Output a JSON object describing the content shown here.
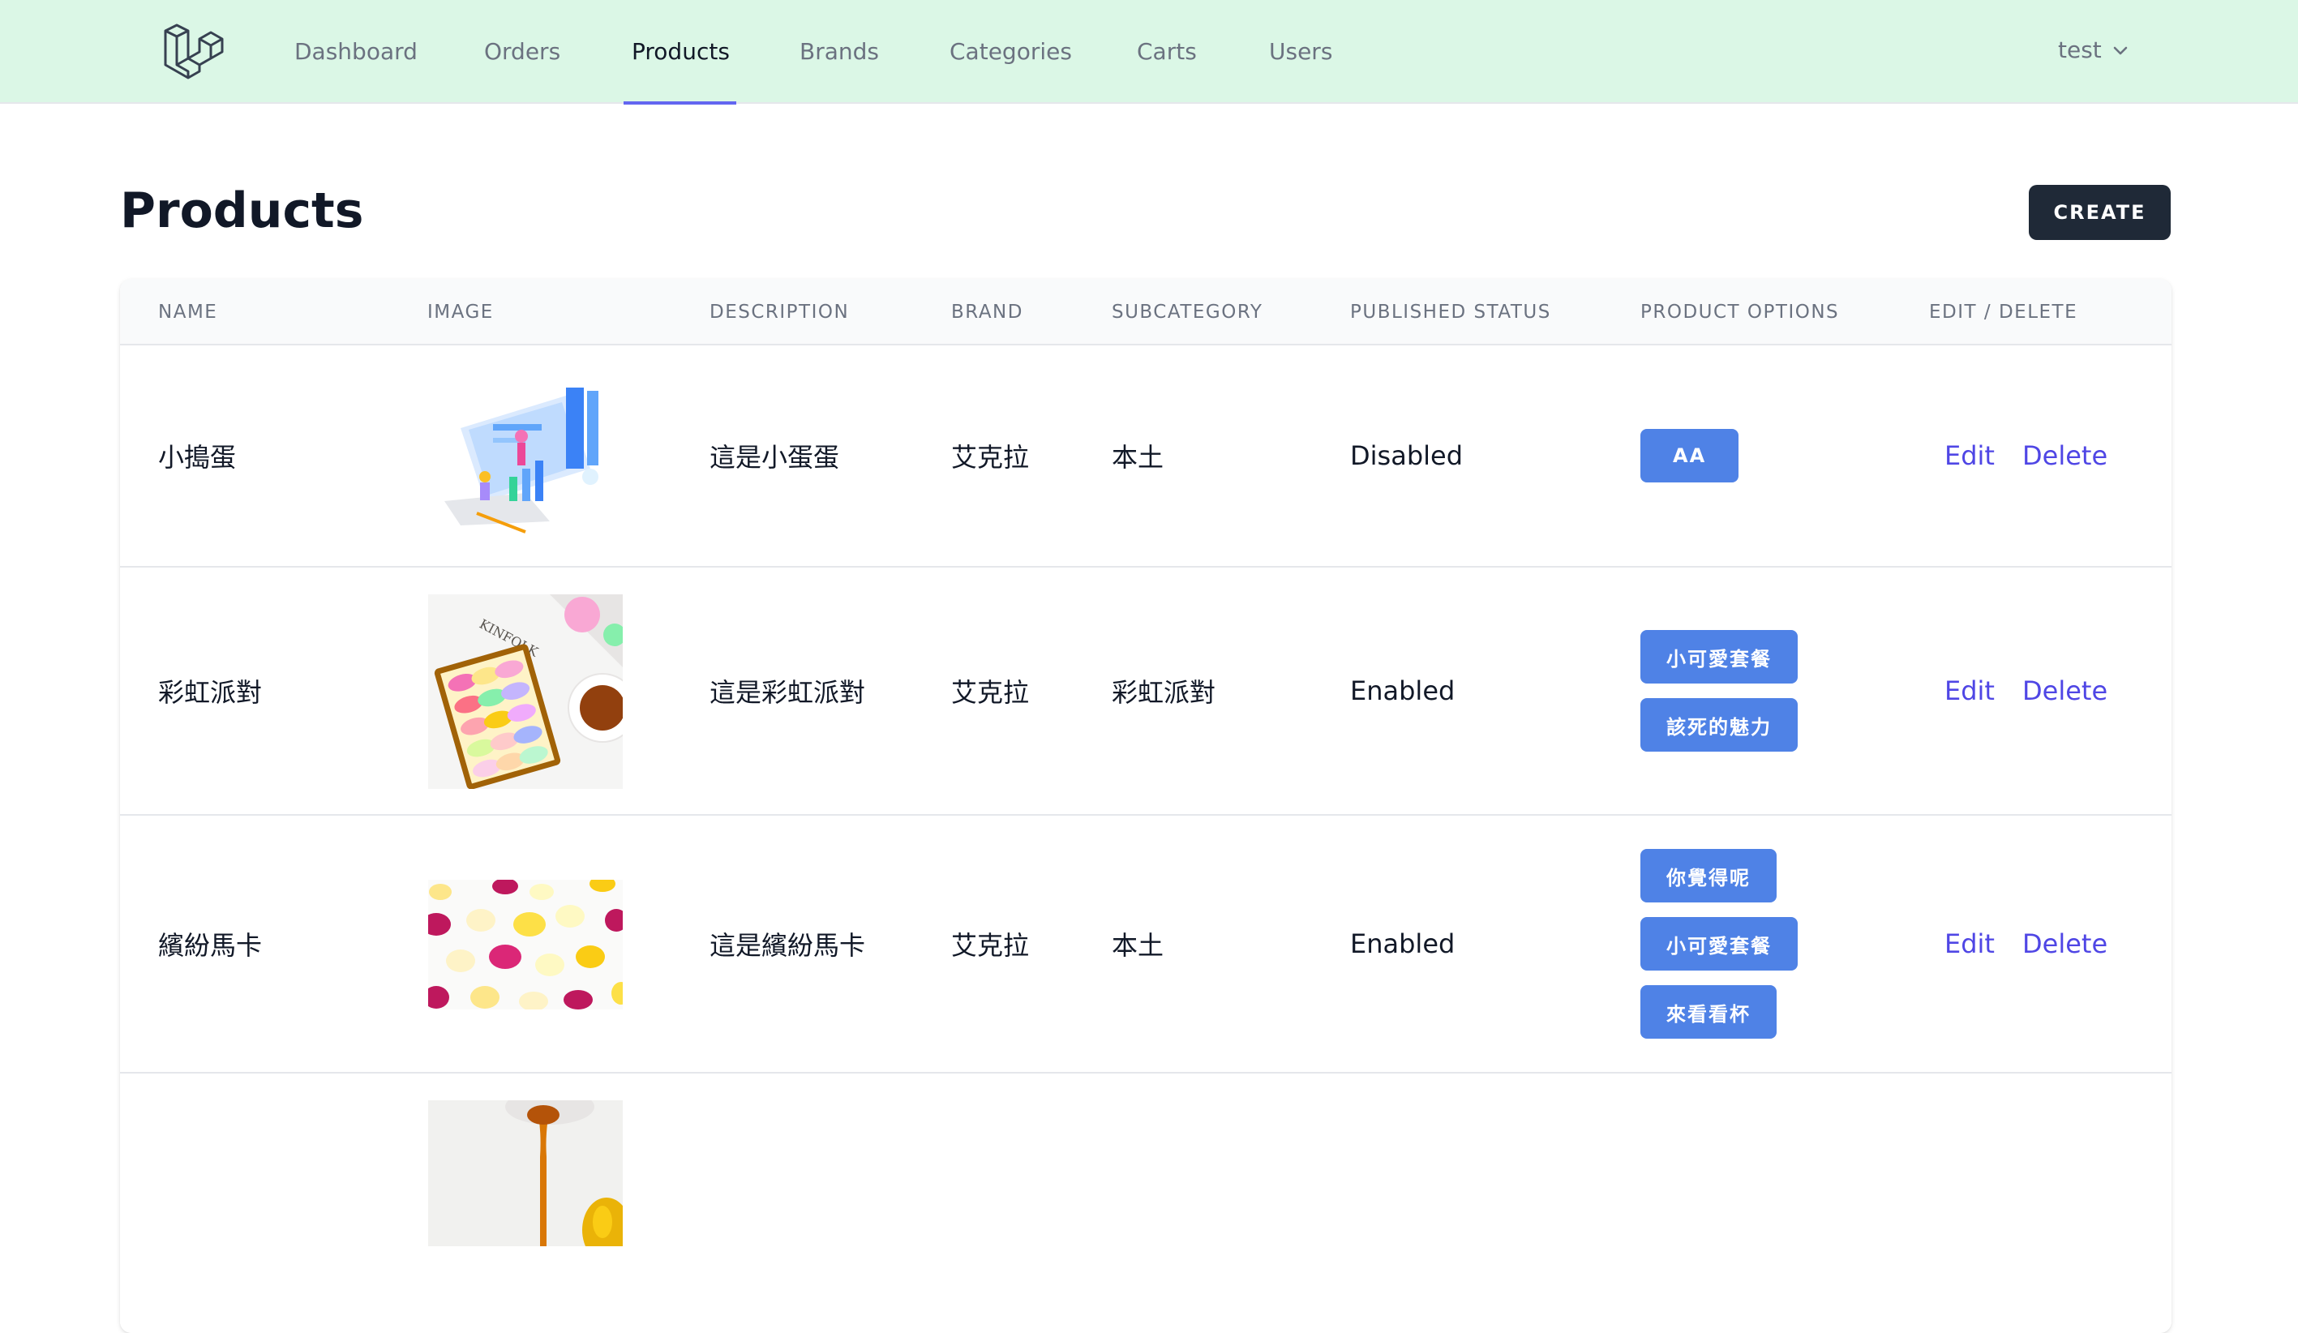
{
  "nav": {
    "items": [
      {
        "label": "Dashboard",
        "active": false
      },
      {
        "label": "Orders",
        "active": false
      },
      {
        "label": "Products",
        "active": true
      },
      {
        "label": "Brands",
        "active": false
      },
      {
        "label": "Categories",
        "active": false
      },
      {
        "label": "Carts",
        "active": false
      },
      {
        "label": "Users",
        "active": false
      }
    ],
    "user": "test",
    "logo_icon": "laravel-logo-icon",
    "active_underline_color": "#6366f1",
    "background_color": "#dbf7e6"
  },
  "page": {
    "title": "Products",
    "create_label": "CREATE"
  },
  "table": {
    "headers": [
      "NAME",
      "IMAGE",
      "DESCRIPTION",
      "BRAND",
      "SUBCATEGORY",
      "PUBLISHED STATUS",
      "PRODUCT OPTIONS",
      "EDIT / DELETE"
    ],
    "edit_label": "Edit",
    "delete_label": "Delete",
    "rows": [
      {
        "name": "小搗蛋",
        "image": "illustration-dashboard-image",
        "description": "這是小蛋蛋",
        "brand": "艾克拉",
        "subcategory": "本土",
        "status": "Disabled",
        "options": [
          "AA"
        ]
      },
      {
        "name": "彩虹派對",
        "image": "macaron-box-photo",
        "description": "這是彩虹派對",
        "brand": "艾克拉",
        "subcategory": "彩虹派對",
        "status": "Enabled",
        "options": [
          "小可愛套餐",
          "該死的魅力"
        ]
      },
      {
        "name": "繽紛馬卡",
        "image": "colorful-macarons-photo",
        "description": "這是繽紛馬卡",
        "brand": "艾克拉",
        "subcategory": "本土",
        "status": "Enabled",
        "options": [
          "你覺得呢",
          "小可愛套餐",
          "來看看杯"
        ]
      },
      {
        "name": "",
        "image": "honey-drip-photo",
        "description": "",
        "brand": "",
        "subcategory": "",
        "status": "",
        "options": []
      }
    ]
  },
  "colors": {
    "primary_button": "#1f2937",
    "option_button": "#4f82e6",
    "action_link": "#4f46e5"
  }
}
